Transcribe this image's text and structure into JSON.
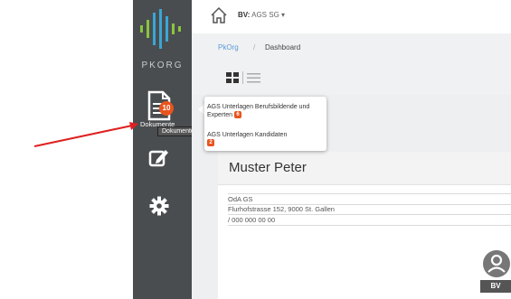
{
  "brand": {
    "name": "PKORG"
  },
  "sidebar": {
    "documents": {
      "label": "Dokumente",
      "badge": "10",
      "tooltip": "Dokumente"
    }
  },
  "topbar": {
    "bv_prefix": "BV:",
    "bv_value": "AGS SG",
    "bv_caret": "▾"
  },
  "breadcrumb": {
    "root": "PkOrg",
    "separator": "/",
    "current": "Dashboard"
  },
  "popup": {
    "items": [
      {
        "label": "AGS Unterlagen Berufsbildende und Experten",
        "badge": "6"
      },
      {
        "label": "AGS Unterlagen Kandidaten",
        "badge": "2"
      }
    ]
  },
  "profile": {
    "name": "Muster Peter",
    "rows": [
      "OdA GS",
      "Flurhofstrasse 152, 9000 St. Gallen",
      "/ 000 000 00 00"
    ]
  },
  "bv_chip": {
    "label": "BV"
  },
  "colors": {
    "sidebar": "#4a4d50",
    "badge": "#e8541e",
    "link": "#5a9ad6",
    "annotation_arrow": "#e02020"
  }
}
